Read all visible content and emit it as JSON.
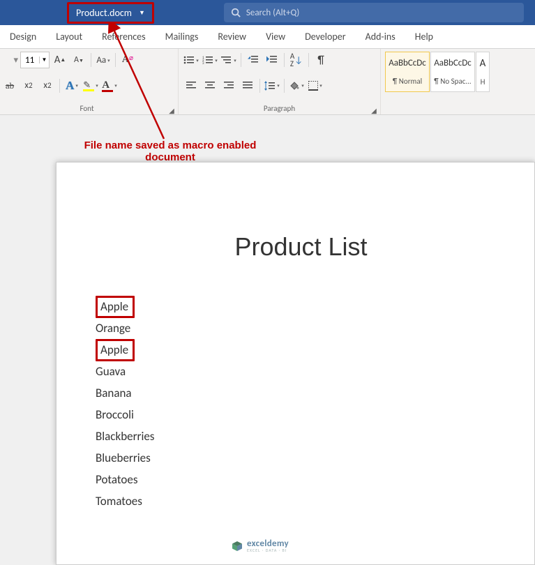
{
  "title_bar": {
    "filename": "Product.docm",
    "search_placeholder": "Search (Alt+Q)"
  },
  "ribbon_tabs": [
    "Design",
    "Layout",
    "References",
    "Mailings",
    "Review",
    "View",
    "Developer",
    "Add-ins",
    "Help"
  ],
  "font_group": {
    "label": "Font",
    "size": "11",
    "increase_tip": "A▲",
    "decrease_tip": "A▼",
    "clear_tip": "Aρ",
    "change_case": "Aa"
  },
  "paragraph_group": {
    "label": "Paragraph"
  },
  "styles": [
    {
      "preview": "AaBbCcDc",
      "name": "¶ Normal",
      "selected": true
    },
    {
      "preview": "AaBbCcDc",
      "name": "¶ No Spac...",
      "selected": false
    },
    {
      "preview": "A",
      "name": "H",
      "selected": false
    }
  ],
  "annotation": {
    "line1": "File name saved as macro enabled",
    "line2": "document"
  },
  "document": {
    "title": "Product List",
    "items": [
      {
        "text": "Apple",
        "highlighted": true
      },
      {
        "text": "Orange",
        "highlighted": false
      },
      {
        "text": "Apple",
        "highlighted": true
      },
      {
        "text": "Guava",
        "highlighted": false
      },
      {
        "text": "Banana",
        "highlighted": false
      },
      {
        "text": "Broccoli",
        "highlighted": false
      },
      {
        "text": "Blackberries",
        "highlighted": false
      },
      {
        "text": "Blueberries",
        "highlighted": false
      },
      {
        "text": "Potatoes",
        "highlighted": false
      },
      {
        "text": "Tomatoes",
        "highlighted": false
      }
    ]
  },
  "watermark": {
    "brand": "exceldemy",
    "sub": "EXCEL · DATA · BI"
  }
}
